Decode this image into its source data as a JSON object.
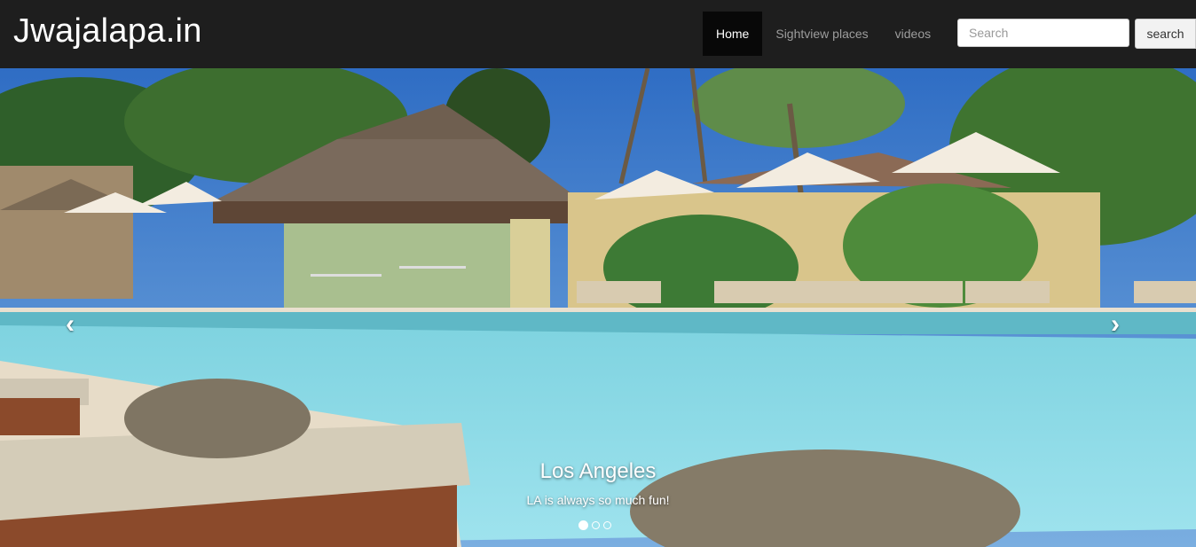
{
  "navbar": {
    "brand": "Jwajalapa.in",
    "items": [
      {
        "label": "Home"
      },
      {
        "label": "Sightview places"
      },
      {
        "label": "videos"
      }
    ],
    "search": {
      "placeholder": "Search",
      "button_label": "search"
    }
  },
  "carousel": {
    "caption_title": "Los Angeles",
    "caption_text": "LA is always so much fun!",
    "prev_icon": "‹",
    "next_icon": "›",
    "slide_count": 3,
    "active_slide": 1
  }
}
